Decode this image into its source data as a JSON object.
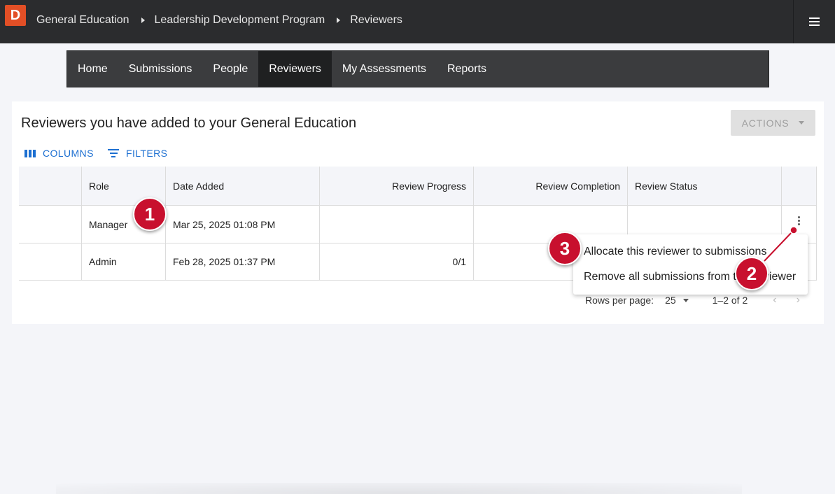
{
  "header": {
    "logo": "D",
    "breadcrumbs": [
      "General Education",
      "Leadership Development Program",
      "Reviewers"
    ]
  },
  "nav": {
    "tabs": [
      "Home",
      "Submissions",
      "People",
      "Reviewers",
      "My Assessments",
      "Reports"
    ],
    "active": "Reviewers"
  },
  "panel": {
    "title": "Reviewers you have added to your General Education",
    "actions_label": "ACTIONS",
    "columns_label": "COLUMNS",
    "filters_label": "FILTERS"
  },
  "table": {
    "headers": [
      "",
      "Role",
      "Date Added",
      "Review Progress",
      "Review Completion",
      "Review Status",
      ""
    ],
    "rows": [
      {
        "role": "Manager",
        "date_added": "Mar 25, 2025 01:08 PM",
        "progress": "",
        "completion": "",
        "status": ""
      },
      {
        "role": "Admin",
        "date_added": "Feb 28, 2025 01:37 PM",
        "progress": "0/1",
        "completion": "",
        "status": ""
      }
    ]
  },
  "pagination": {
    "rows_per_page_label": "Rows per page:",
    "rows_per_page": "25",
    "range": "1–2 of 2"
  },
  "context_menu": {
    "items": [
      "Allocate this reviewer to submissions",
      "Remove all submissions from this reviewer"
    ]
  },
  "annotations": [
    "1",
    "2",
    "3"
  ],
  "colors": {
    "topbar": "#2b2c2e",
    "logo": "#e24f26",
    "link": "#1c6fd1",
    "badge": "#c8102e"
  }
}
